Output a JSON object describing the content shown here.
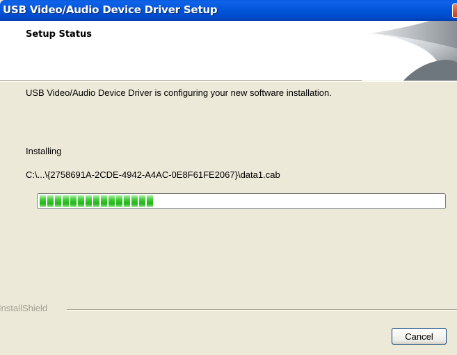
{
  "window": {
    "title": "USB Video/Audio Device Driver Setup"
  },
  "header": {
    "title": "Setup Status"
  },
  "body": {
    "status_message": "USB Video/Audio Device Driver is configuring your new software installation.",
    "action_label": "Installing",
    "file_path": "C:\\...\\{2758691A-2CDE-4942-A4AC-0E8F61FE2067}\\data1.cab",
    "progress_fraction": 0.29
  },
  "footer": {
    "brand_label": "InstallShield",
    "cancel_label": "Cancel"
  },
  "colors": {
    "titlebar": "#0053d6",
    "dialog_bg": "#ece9d8",
    "progress_fill": "#2cbe22",
    "close_button": "#d9573a"
  },
  "icons": {
    "close": "close-icon",
    "header_art": "installshield-banner-art"
  }
}
